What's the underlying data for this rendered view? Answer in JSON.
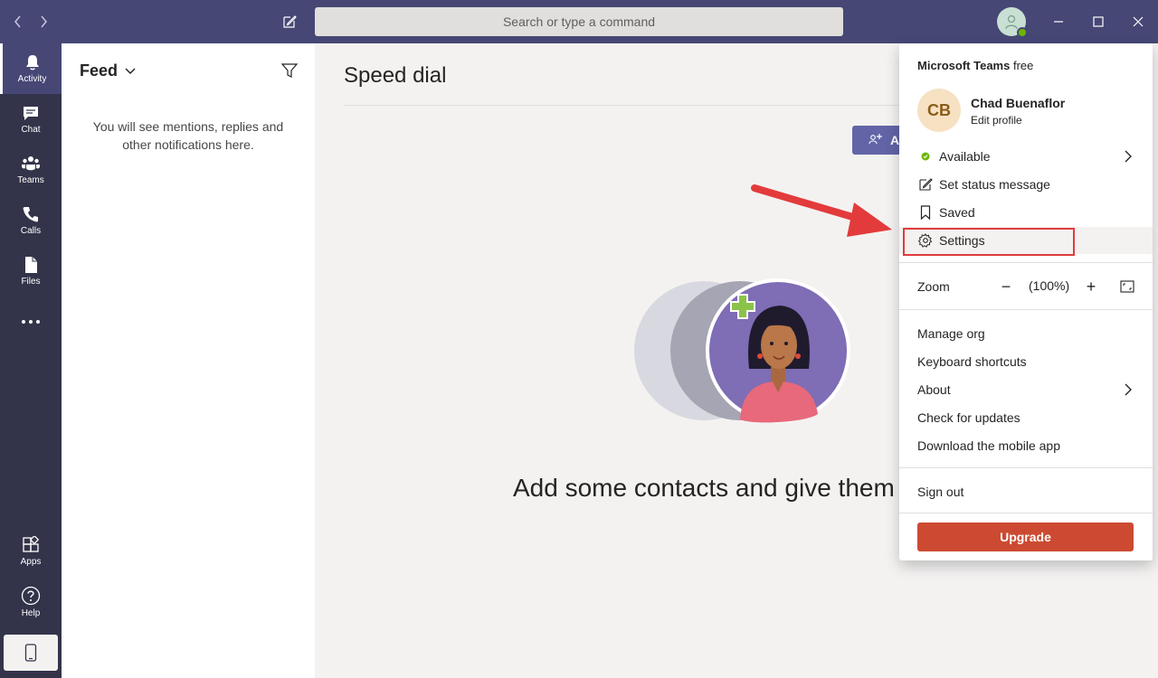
{
  "titlebar": {
    "search_placeholder": "Search or type a command"
  },
  "rail": {
    "items": [
      {
        "label": "Activity",
        "icon": "bell-icon",
        "active": true
      },
      {
        "label": "Chat",
        "icon": "chat-icon"
      },
      {
        "label": "Teams",
        "icon": "teams-icon"
      },
      {
        "label": "Calls",
        "icon": "phone-icon"
      },
      {
        "label": "Files",
        "icon": "file-icon"
      },
      {
        "label": "",
        "icon": "more-icon"
      }
    ],
    "bottom": [
      {
        "label": "Apps",
        "icon": "apps-icon"
      },
      {
        "label": "Help",
        "icon": "help-icon"
      }
    ]
  },
  "feed": {
    "title": "Feed",
    "empty_message": "You will see mentions, replies and other notifications here."
  },
  "main": {
    "title": "Speed dial",
    "add_button_label": "A",
    "headline": "Add some contacts and give them"
  },
  "menu": {
    "brand": "Microsoft Teams",
    "brand_suffix": "free",
    "profile": {
      "initials": "CB",
      "name": "Chad Buenaflor",
      "edit": "Edit profile"
    },
    "status": "Available",
    "set_status": "Set status message",
    "saved": "Saved",
    "settings": "Settings",
    "zoom": {
      "label": "Zoom",
      "minus": "−",
      "value": "(100%)",
      "plus": "+"
    },
    "manage_org": "Manage org",
    "keyboard_shortcuts": "Keyboard shortcuts",
    "about": "About",
    "check_updates": "Check for updates",
    "download_mobile": "Download the mobile app",
    "sign_out": "Sign out",
    "upgrade": "Upgrade"
  },
  "colors": {
    "titlebar": "#464775",
    "rail": "#33344a",
    "accent": "#6264a7",
    "upgrade": "#cc4a31",
    "highlight_border": "#e03c3c",
    "presence": "#6bb700"
  }
}
